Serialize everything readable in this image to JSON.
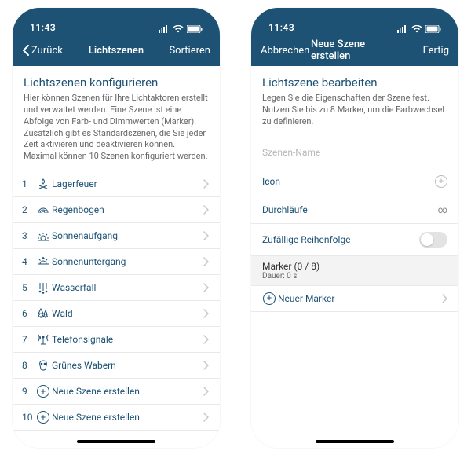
{
  "status": {
    "time": "11:43"
  },
  "left": {
    "nav": {
      "back": "Zurück",
      "title": "Lichtszenen",
      "right": "Sortieren"
    },
    "section_title": "Lichtszenen konfigurieren",
    "section_desc": "Hier können Szenen für Ihre Lichtaktoren erstellt und verwaltet werden. Eine Szene ist eine Abfolge von Farb- und Dimmwerten (Marker). Zusätzlich gibt es Standardszenen, die Sie jeder Zeit aktivieren und deaktivieren können. Maximal können 10 Szenen konfiguriert werden.",
    "items": [
      {
        "num": "1",
        "icon": "campfire-icon",
        "label": "Lagerfeuer"
      },
      {
        "num": "2",
        "icon": "rainbow-icon",
        "label": "Regenbogen"
      },
      {
        "num": "3",
        "icon": "sunrise-icon",
        "label": "Sonnenaufgang"
      },
      {
        "num": "4",
        "icon": "sunset-icon",
        "label": "Sonnenuntergang"
      },
      {
        "num": "5",
        "icon": "waterfall-icon",
        "label": "Wasserfall"
      },
      {
        "num": "6",
        "icon": "forest-icon",
        "label": "Wald"
      },
      {
        "num": "7",
        "icon": "antenna-icon",
        "label": "Telefonsignale"
      },
      {
        "num": "8",
        "icon": "blob-icon",
        "label": "Grünes Wabern"
      },
      {
        "num": "9",
        "icon": "plus-icon",
        "label": "Neue Szene erstellen"
      },
      {
        "num": "10",
        "icon": "plus-icon",
        "label": "Neue Szene erstellen"
      }
    ]
  },
  "right": {
    "nav": {
      "cancel": "Abbrechen",
      "title": "Neue Szene erstellen",
      "done": "Fertig"
    },
    "section_title": "Lichtszene bearbeiten",
    "section_desc": "Legen Sie die Eigenschaften der Szene fest. Nutzen Sie bis zu 8 Marker, um die Farbwechsel zu definieren.",
    "name_placeholder": "Szenen-Name",
    "rows": {
      "icon_label": "Icon",
      "loops_label": "Durchläufe",
      "loops_value": "∞",
      "random_label": "Zufällige Reihenfolge",
      "marker_title": "Marker (0 / 8)",
      "marker_sub": "Dauer: 0 s",
      "new_marker": "Neuer Marker"
    }
  }
}
